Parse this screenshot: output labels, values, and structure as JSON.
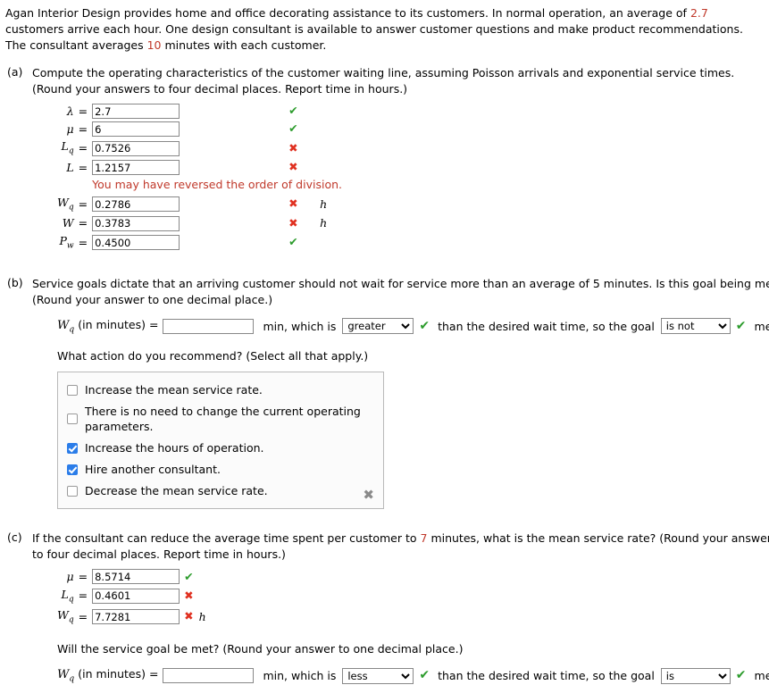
{
  "intro": {
    "text_1": "Agan Interior Design provides home and office decorating assistance to its customers. In normal operation, an average of ",
    "num_1": "2.7",
    "text_2": " customers arrive each hour. One design consultant is available to answer customer questions and make product recommendations. The consultant averages ",
    "num_2": "10",
    "text_3": " minutes with each customer."
  },
  "parts": {
    "a": {
      "label": "(a)",
      "prompt": "Compute the operating characteristics of the customer waiting line, assuming Poisson arrivals and exponential service times. (Round your answers to four decimal places. Report time in hours.)",
      "rows": [
        {
          "symbol": "λ",
          "sub": "",
          "eq": "=",
          "value": "2.7",
          "mark": "ok",
          "unit": ""
        },
        {
          "symbol": "μ",
          "sub": "",
          "eq": "=",
          "value": "6",
          "mark": "ok",
          "unit": ""
        },
        {
          "symbol": "L",
          "sub": "q",
          "eq": "=",
          "value": "0.7526",
          "mark": "bad",
          "unit": ""
        },
        {
          "symbol": "L",
          "sub": "",
          "eq": "=",
          "value": "1.2157",
          "mark": "bad",
          "unit": ""
        }
      ],
      "error_message": "You may have reversed the order of division.",
      "rows2": [
        {
          "symbol": "W",
          "sub": "q",
          "eq": "=",
          "value": "0.2786",
          "mark": "bad",
          "unit": "h"
        },
        {
          "symbol": "W",
          "sub": "",
          "eq": "=",
          "value": "0.3783",
          "mark": "bad",
          "unit": "h"
        },
        {
          "symbol": "P",
          "sub": "w",
          "eq": "=",
          "value": "0.4500",
          "mark": "ok",
          "unit": ""
        }
      ]
    },
    "b": {
      "label": "(b)",
      "prompt": "Service goals dictate that an arriving customer should not wait for service more than an average of 5 minutes. Is this goal being met? (Round your answer to one decimal place.)",
      "wq_label": "W",
      "wq_sub": "q",
      "wq_unit_label": "(in minutes) =",
      "wq_value": "",
      "after_input": "min, which is",
      "select1_value": "greater",
      "select1_mark": "ok",
      "middle_text": "than the desired wait time, so the goal",
      "select2_value": "is not",
      "select2_mark": "ok",
      "end_text": "met.",
      "action_question": "What action do you recommend? (Select all that apply.)",
      "options": [
        {
          "label": "Increase the mean service rate.",
          "checked": false
        },
        {
          "label": "There is no need to change the current operating parameters.",
          "checked": false
        },
        {
          "label": "Increase the hours of operation.",
          "checked": true
        },
        {
          "label": "Hire another consultant.",
          "checked": true
        },
        {
          "label": "Decrease the mean service rate.",
          "checked": false
        }
      ],
      "box_mark": "✖"
    },
    "c": {
      "label": "(c)",
      "prompt_1": "If the consultant can reduce the average time spent per customer to ",
      "prompt_num": "7",
      "prompt_2": " minutes, what is the mean service rate? (Round your answers to four decimal places. Report time in hours.)",
      "rows": [
        {
          "symbol": "μ",
          "sub": "",
          "eq": "=",
          "value": "8.5714",
          "mark": "ok",
          "unit": ""
        },
        {
          "symbol": "L",
          "sub": "q",
          "eq": "=",
          "value": "0.4601",
          "mark": "bad",
          "unit": ""
        },
        {
          "symbol": "W",
          "sub": "q",
          "eq": "=",
          "value": "7.7281",
          "mark": "bad",
          "unit": "h"
        }
      ],
      "goal_question": "Will the service goal be met? (Round your answer to one decimal place.)",
      "wq_label": "W",
      "wq_sub": "q",
      "wq_unit_label": "(in minutes) =",
      "wq_value": "",
      "after_input": "min, which is",
      "select1_value": "less",
      "select1_mark": "ok",
      "middle_text": "than the desired wait time, so the goal",
      "select2_value": "is",
      "select2_mark": "ok",
      "end_text": "met."
    }
  },
  "marks": {
    "ok_glyph": "✔",
    "bad_glyph": "✖"
  }
}
